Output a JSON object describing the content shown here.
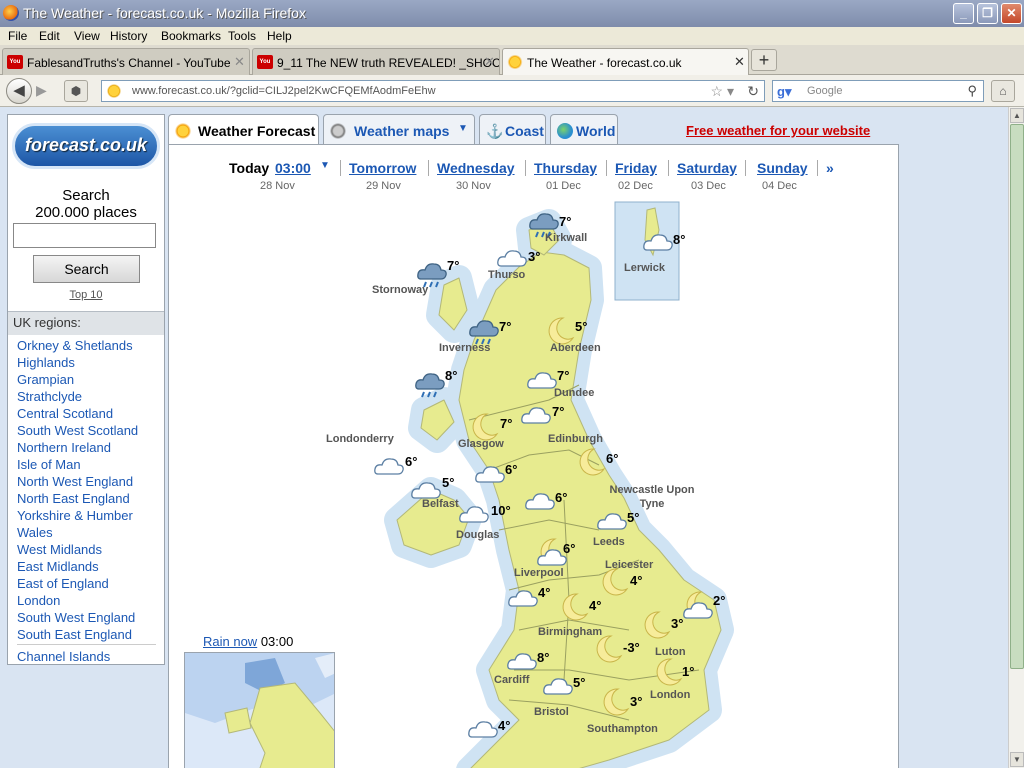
{
  "window": {
    "title": "The Weather - forecast.co.uk - Mozilla Firefox"
  },
  "menu": [
    "File",
    "Edit",
    "View",
    "History",
    "Bookmarks",
    "Tools",
    "Help"
  ],
  "tabs": [
    {
      "label": "FablesandTruths's Channel - YouTube",
      "icon": "youtube-icon"
    },
    {
      "label": "9_11 The NEW truth REVEALED! _SHOCK...",
      "icon": "youtube-icon"
    },
    {
      "label": "The Weather - forecast.co.uk",
      "icon": "sun-icon"
    }
  ],
  "address": {
    "url": "www.forecast.co.uk/?gclid=CILJ2pel2KwCFQEMfAodmFeEhw"
  },
  "search": {
    "engine": "Google",
    "placeholder": "Google"
  },
  "sidebar": {
    "logo": "forecast.co.uk",
    "search_title_1": "Search",
    "search_title_2": "200.000 places",
    "search_button": "Search",
    "top10": "Top 10",
    "regions_title": "UK regions:",
    "regions": [
      "Orkney & Shetlands",
      "Highlands",
      "Grampian",
      "Strathclyde",
      "Central Scotland",
      "South West Scotland",
      "Northern Ireland",
      "Isle of Man",
      "North West England",
      "North East England",
      "Yorkshire & Humber",
      "Wales",
      "West Midlands",
      "East Midlands",
      "East of England",
      "London",
      "South West England",
      "South East England",
      "Channel Islands"
    ]
  },
  "nav_tabs": [
    {
      "label": "Weather Forecast"
    },
    {
      "label": "Weather maps"
    },
    {
      "label": "Coast"
    },
    {
      "label": "World"
    }
  ],
  "free_link": "Free weather for your website",
  "days": [
    {
      "label": "Today",
      "time": "03:00",
      "date": "28 Nov"
    },
    {
      "label": "Tomorrow",
      "date": "29 Nov"
    },
    {
      "label": "Wednesday",
      "date": "30 Nov"
    },
    {
      "label": "Thursday",
      "date": "01 Dec"
    },
    {
      "label": "Friday",
      "date": "02 Dec"
    },
    {
      "label": "Saturday",
      "date": "03 Dec"
    },
    {
      "label": "Sunday",
      "date": "04 Dec"
    },
    {
      "label": "»"
    }
  ],
  "cities": [
    {
      "name": "Kirkwall",
      "temp": "7°",
      "icon": "rain-cloud-icon"
    },
    {
      "name": "Lerwick",
      "temp": "8°",
      "icon": "cloud-icon"
    },
    {
      "name": "Stornoway",
      "temp": "7°",
      "icon": "rain-cloud-icon"
    },
    {
      "name": "Thurso",
      "temp": "3°",
      "icon": "cloud-icon"
    },
    {
      "name": "Inverness",
      "temp": "7°",
      "icon": "rain-cloud-icon"
    },
    {
      "name": "Aberdeen",
      "temp": "5°",
      "icon": "moon-icon"
    },
    {
      "name": "",
      "temp": "8°",
      "icon": "rain-cloud-icon"
    },
    {
      "name": "Dundee",
      "temp": "7°",
      "icon": "cloud-icon"
    },
    {
      "name": "Edinburgh",
      "temp": "7°",
      "icon": "cloud-icon"
    },
    {
      "name": "Glasgow",
      "temp": "7°",
      "icon": "moon-icon"
    },
    {
      "name": "Londonderry",
      "temp": "6°",
      "icon": "cloud-icon"
    },
    {
      "name": "Belfast",
      "temp": "5°",
      "icon": "cloud-icon"
    },
    {
      "name": "",
      "temp": "6°",
      "icon": "cloud-icon"
    },
    {
      "name": "Newcastle Upon Tyne",
      "temp": "6°",
      "icon": "moon-icon"
    },
    {
      "name": "Douglas",
      "temp": "10°",
      "icon": "cloud-icon"
    },
    {
      "name": "",
      "temp": "6°",
      "icon": "cloud-icon"
    },
    {
      "name": "Leeds",
      "temp": "5°",
      "icon": "cloud-icon"
    },
    {
      "name": "Liverpool",
      "temp": "6°",
      "icon": "moon-cloud-icon"
    },
    {
      "name": "Leicester",
      "temp": "4°",
      "icon": "moon-icon"
    },
    {
      "name": "",
      "temp": "4°",
      "icon": "cloud-icon"
    },
    {
      "name": "Birmingham",
      "temp": "4°",
      "icon": "moon-icon"
    },
    {
      "name": "",
      "temp": "2°",
      "icon": "moon-cloud-icon"
    },
    {
      "name": "Luton",
      "temp": "3°",
      "icon": "moon-icon"
    },
    {
      "name": "Cardiff",
      "temp": "8°",
      "icon": "cloud-icon"
    },
    {
      "name": "",
      "temp": "-3°",
      "icon": "moon-icon"
    },
    {
      "name": "London",
      "temp": "1°",
      "icon": "moon-icon"
    },
    {
      "name": "Bristol",
      "temp": "5°",
      "icon": "cloud-icon"
    },
    {
      "name": "Southampton",
      "temp": "3°",
      "icon": "moon-icon"
    },
    {
      "name": "",
      "temp": "4°",
      "icon": "cloud-icon"
    }
  ],
  "rain_now": {
    "label": "Rain now",
    "time": "03:00"
  },
  "colors": {
    "land": "#e7eb8f",
    "sea_halo": "#cfe3f3",
    "link": "#1c58b4",
    "free_link": "#cc0000",
    "accent_red": "#cc0000"
  }
}
